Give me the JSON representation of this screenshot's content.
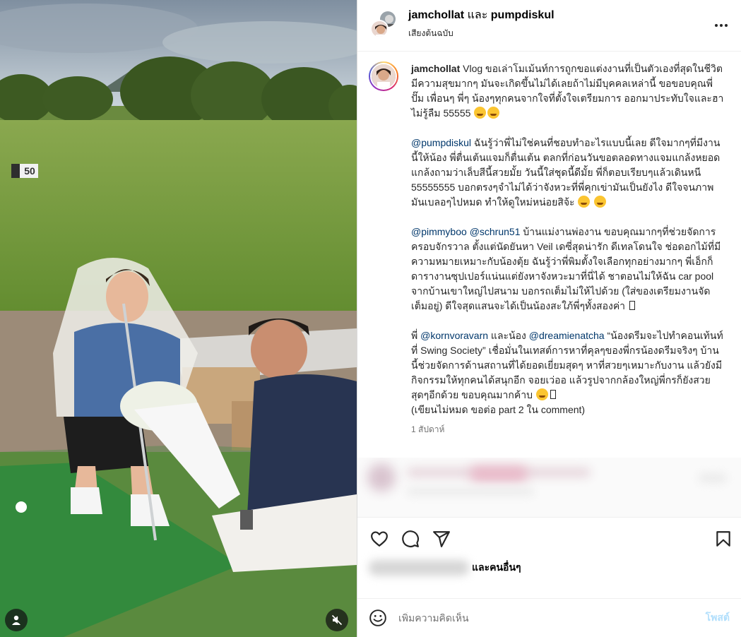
{
  "header": {
    "user1": "jamchollat",
    "and_word": "และ",
    "user2": "pumpdiskul",
    "audio": "เสียงต้นฉบับ"
  },
  "media": {
    "range_sign": "50"
  },
  "caption": {
    "username": "jamchollat",
    "p1": "Vlog ขอเล่าโมเม้นท์การถูกขอแต่งงานที่เป็นตัวเองที่สุดในชีวิต มีความสุขมากๆ มันจะเกิดขึ้นไม่ได้เลยถ้าไม่มีบุคคลเหล่านี้ ขอขอบคุณพี่ปั๊ม เพื่อนๆ พี่ๆ น้องๆทุกคนจากใจที่ตั้งใจเตรียมการ ออกมาประทับใจและฮาไม่รู้ลืม 55555",
    "p2_mention": "@pumpdiskul",
    "p2": " ฉันรู้ว่าพี่ไม่ใช่คนที่ชอบทำอะไรแบบนี้เลย ดีใจมากๆที่มีงานนี้ให้น้อง พี่ตื่นเต้นแจมก็ตื่นเต้น ตลกที่ก่อนวันขอตลอดทางแจมแกล้งหยอดแกล้งถามว่าเล็บสีนี้สวยมั้ย วันนี้ใส่ชุดนี้ดีมั้ย พี่ก็ตอบเรียบๆแล้วเดินหนี 55555555 บอกตรงๆจำไม่ได้ว่าจังหวะที่พี่คุกเข่ามันเป็นยังไง ดีใจจนภาพมันเบลอๆไปหมด ทำให้ดูใหม่หน่อยสิจ้ะ",
    "p3_mention1": "@pimmyboo",
    "p3_mention2": "@schrun51",
    "p3": " บ้านแม่งานพ่องาน ขอบคุณมากๆที่ช่วยจัดการครอบจักรวาล ตั้งแต่นัดยันหา Veil เดซี่สุดน่ารัก ดีเทลโดนใจ ช่อดอกไม้ที่มีความหมายเหมาะกับน้องตุ้ย ฉันรู้ว่าพี่พิมตั้งใจเลือกทุกอย่างมากๆ พี่เอ็กก็ดารางานซุปเปอร์แน่นแต่ยังหาจังหวะมาที่นี่ได้ ชาตอนไม่ให้ฉัน car pool จากบ้านเขาใหญ่ไปสนาม บอกรถเต็มไม่ให้ไปด้วย (ใส่ของเตรียมงานจัดเต็มอยู่) ดีใจสุดแสนจะได้เป็นน้องสะใภ้พี่ๆทั้งสองค่า",
    "p4_prefix": "พี่ ",
    "p4_mention1": "@kornvoravarn",
    "p4_mid": " และน้อง ",
    "p4_mention2": "@dreamienatcha",
    "p4": " “น้องดรีมจะไปทำคอนเท้นท์ที่ Swing Society” เชื่อมั่นในเทสต์การหาที่คุลๆของพี่กรน้องดรีมจริงๆ บ้านนี้ช่วยจัดการด้านสถานที่ได้ยอดเยี่ยมสุดๆ หาที่สวยๆเหมาะกับงาน แล้วยังมีกิจกรรมให้ทุกคนได้สนุกอีก จอยเว่ออ แล้วรูปจากกล้องใหญ่พี่กรก็ยังสวยสุดๆอีกด้วย ขอบคุณมากค้าบ",
    "p4_end": "(เขียนไม่หมด ขอต่อ part 2 ใน comment)",
    "time": "1 สัปดาห์"
  },
  "actions": {
    "likes_suffix": "และคนอื่นๆ"
  },
  "comment_box": {
    "placeholder": "เพิ่มความคิดเห็น",
    "post_label": "โพสต์"
  },
  "colors": {
    "mention": "#00376b",
    "post_button": "#b2dffc",
    "border": "#dbdbdb"
  },
  "icons": [
    "more-icon",
    "heart-icon",
    "comment-icon",
    "share-icon",
    "save-icon",
    "emoji-icon",
    "user-icon",
    "mute-icon"
  ]
}
